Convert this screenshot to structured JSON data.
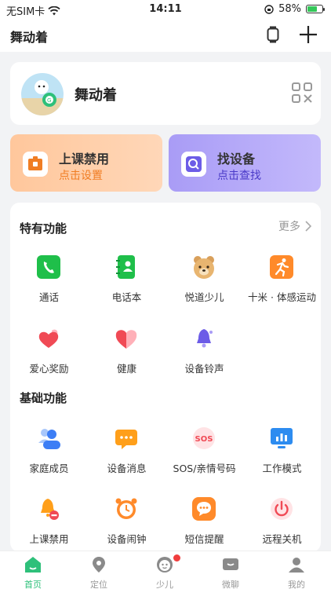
{
  "status_bar": {
    "carrier": "无SIM卡",
    "time": "14:11",
    "battery": "58%"
  },
  "header": {
    "title": "舞动着"
  },
  "profile": {
    "name": "舞动着"
  },
  "promo": [
    {
      "title": "上课禁用",
      "subtitle": "点击设置"
    },
    {
      "title": "找设备",
      "subtitle": "点击查找"
    }
  ],
  "special": {
    "title": "特有功能",
    "more": "更多",
    "items": [
      {
        "label": "通话",
        "icon": "phone-icon"
      },
      {
        "label": "电话本",
        "icon": "contacts-book-icon"
      },
      {
        "label": "悦道少儿",
        "icon": "bear-icon"
      },
      {
        "label": "十米 · 体感运动",
        "icon": "running-icon"
      },
      {
        "label": "爱心奖励",
        "icon": "hearts-icon"
      },
      {
        "label": "健康",
        "icon": "heart-icon"
      },
      {
        "label": "设备铃声",
        "icon": "bell-icon"
      }
    ]
  },
  "basic": {
    "title": "基础功能",
    "items": [
      {
        "label": "家庭成员",
        "icon": "family-icon"
      },
      {
        "label": "设备消息",
        "icon": "message-icon"
      },
      {
        "label": "SOS/亲情号码",
        "icon": "sos-icon"
      },
      {
        "label": "工作模式",
        "icon": "work-mode-icon"
      },
      {
        "label": "上课禁用",
        "icon": "class-disable-icon"
      },
      {
        "label": "设备闹钟",
        "icon": "alarm-icon"
      },
      {
        "label": "短信提醒",
        "icon": "sms-icon"
      },
      {
        "label": "远程关机",
        "icon": "power-icon"
      }
    ]
  },
  "tabbar": [
    {
      "label": "首页",
      "active": true
    },
    {
      "label": "定位"
    },
    {
      "label": "少儿"
    },
    {
      "label": "微聊"
    },
    {
      "label": "我的"
    }
  ],
  "colors": {
    "accent": "#2ec07a",
    "orange": "#f07d23",
    "purple": "#4a3ac8"
  }
}
